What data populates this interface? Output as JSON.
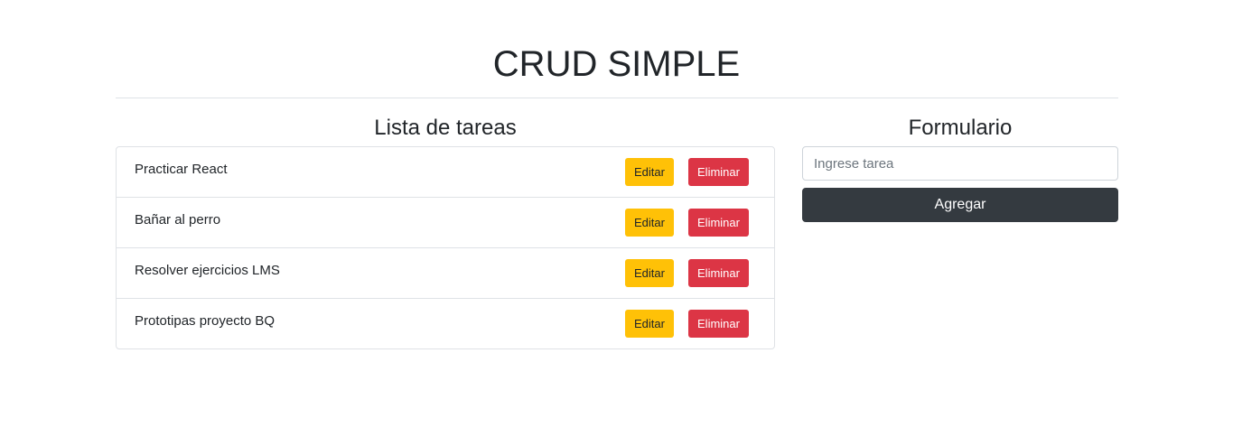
{
  "header": {
    "title": "CRUD SIMPLE"
  },
  "list": {
    "title": "Lista de tareas",
    "edit_label": "Editar",
    "delete_label": "Eliminar",
    "items": [
      {
        "text": "Practicar React"
      },
      {
        "text": "Bañar al perro"
      },
      {
        "text": "Resolver ejercicios LMS"
      },
      {
        "text": "Prototipas proyecto BQ"
      }
    ]
  },
  "form": {
    "title": "Formulario",
    "input_placeholder": "Ingrese tarea",
    "input_value": "",
    "submit_label": "Agregar"
  },
  "colors": {
    "edit": "#ffc107",
    "delete": "#dc3545",
    "submit": "#343a40"
  }
}
